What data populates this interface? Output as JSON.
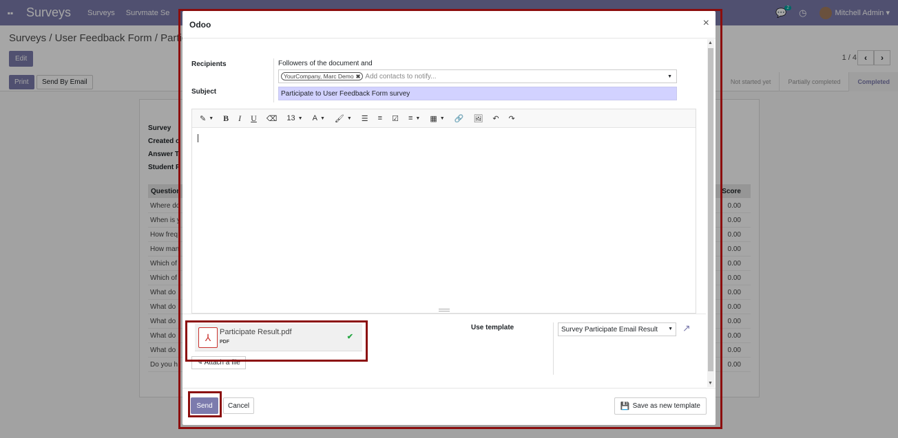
{
  "navbar": {
    "brand": "Surveys",
    "menus": [
      "Surveys",
      "Survmate Se"
    ],
    "chat_badge": "2",
    "user": "Mitchell Admin"
  },
  "control_panel": {
    "breadcrumb": "Surveys / User Feedback Form / Partic",
    "edit_label": "Edit",
    "pager": "1 / 4",
    "print_label": "Print",
    "send_email_label": "Send By Email",
    "stages": [
      "Not started yet",
      "Partially completed",
      "Completed"
    ]
  },
  "sheet": {
    "labels": [
      "Survey",
      "Created o",
      "Answer T",
      "Student R"
    ],
    "col_question": "Question",
    "col_score": "Score",
    "rows": [
      {
        "q": "Where do",
        "s": "0.00"
      },
      {
        "q": "When is y",
        "s": "0.00"
      },
      {
        "q": "How freq",
        "s": "0.00"
      },
      {
        "q": "How man",
        "s": "0.00"
      },
      {
        "q": "Which of",
        "s": "0.00"
      },
      {
        "q": "Which of",
        "s": "0.00"
      },
      {
        "q": "What do",
        "s": "0.00"
      },
      {
        "q": "What do",
        "s": "0.00"
      },
      {
        "q": "What do",
        "s": "0.00"
      },
      {
        "q": "What do",
        "s": "0.00"
      },
      {
        "q": "What do",
        "s": "0.00"
      },
      {
        "q": "Do you h",
        "s": "0.00"
      }
    ]
  },
  "modal": {
    "title": "Odoo",
    "recipients_label": "Recipients",
    "followers_text": "Followers of the document and",
    "recipient_tag": "YourCompany, Marc Demo",
    "recipients_placeholder": "Add contacts to notify...",
    "subject_label": "Subject",
    "subject_value": "Participate to User Feedback Form survey",
    "toolbar": {
      "font_size": "13"
    },
    "attachment": {
      "name": "Participate Result.pdf",
      "type": "PDF",
      "attach_button": "Attach a file"
    },
    "template_label": "Use template",
    "template_value": "Survey Participate Email Result",
    "send_label": "Send",
    "cancel_label": "Cancel",
    "save_template_label": "Save as new template"
  }
}
